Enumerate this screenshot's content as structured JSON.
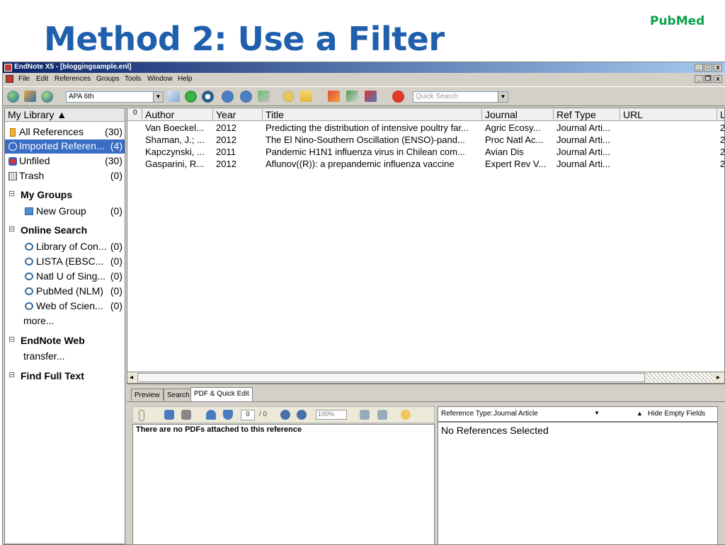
{
  "slide": {
    "title": "Method 2: Use a Filter",
    "tag": "PubMed"
  },
  "window": {
    "title": "EndNote X5 - [bloggingsample.enl]",
    "controls": {
      "minimize": "_",
      "restore": "□",
      "close": "x"
    },
    "doc_controls": {
      "minimize": "_",
      "restore": "❐",
      "close": "x"
    }
  },
  "menu": [
    "File",
    "Edit",
    "References",
    "Groups",
    "Tools",
    "Window",
    "Help"
  ],
  "toolbar": {
    "style_value": "APA 6th",
    "quick_search_placeholder": "Quick Search",
    "dropdown_glyph": "▼"
  },
  "library": {
    "header": "My Library ▲",
    "items": [
      {
        "label": "All References",
        "count": "(30)"
      },
      {
        "label": "Imported Referen...",
        "count": "(4)"
      },
      {
        "label": "Unfiled",
        "count": "(30)"
      },
      {
        "label": "Trash",
        "count": "(0)"
      }
    ],
    "groups": {
      "my_groups": {
        "title": "My Groups",
        "items": [
          {
            "label": "New Group",
            "count": "(0)"
          }
        ]
      },
      "online_search": {
        "title": "Online Search",
        "items": [
          {
            "label": "Library of Con...",
            "count": "(0)"
          },
          {
            "label": "LISTA (EBSC...",
            "count": "(0)"
          },
          {
            "label": "Natl U of Sing...",
            "count": "(0)"
          },
          {
            "label": "PubMed (NLM)",
            "count": "(0)"
          },
          {
            "label": "Web of Scien...",
            "count": "(0)"
          }
        ],
        "more": "more..."
      },
      "endnote_web": {
        "title": "EndNote Web",
        "transfer": "transfer..."
      },
      "find_full_text": {
        "title": "Find Full Text"
      },
      "toggle": "⊟"
    }
  },
  "references": {
    "columns": [
      "Author",
      "Year",
      "Title",
      "Journal",
      "Ref Type",
      "URL",
      "L"
    ],
    "attachment_icon": "0",
    "rows": [
      {
        "author": "Van Boeckel...",
        "year": "2012",
        "title": "Predicting the distribution of intensive poultry far...",
        "journal": "Agric Ecosy...",
        "ref_type": "Journal Arti...",
        "last": "2"
      },
      {
        "author": "Shaman, J.; ...",
        "year": "2012",
        "title": "The El Nino-Southern Oscillation (ENSO)-pand...",
        "journal": "Proc Natl Ac...",
        "ref_type": "Journal Arti...",
        "last": "2"
      },
      {
        "author": "Kapczynski, ...",
        "year": "2011",
        "title": "Pandemic H1N1 influenza virus in Chilean com...",
        "journal": "Avian Dis",
        "ref_type": "Journal Arti...",
        "last": "2"
      },
      {
        "author": "Gasparini, R...",
        "year": "2012",
        "title": "Aflunov((R)): a prepandemic influenza vaccine",
        "journal": "Expert Rev V...",
        "ref_type": "Journal Arti...",
        "last": "2"
      }
    ],
    "scroll_left": "◂",
    "scroll_right": "▸"
  },
  "bottom": {
    "tabs": [
      "Preview",
      "Search",
      "PDF & Quick Edit"
    ],
    "pdf_page_value": "0",
    "pdf_page_total": "/ 0",
    "pdf_zoom": "100%",
    "pdf_message": "There are no PDFs attached to this reference",
    "ref_type_label": "Reference Type:",
    "ref_type_value": "Journal Article",
    "hide_empty": "Hide Empty Fields",
    "no_refs": "No References Selected"
  }
}
